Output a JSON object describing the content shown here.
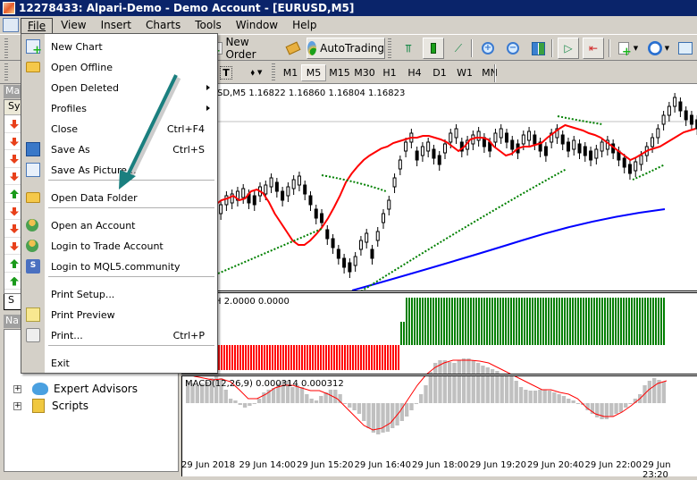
{
  "window": {
    "title": "12278433: Alpari-Demo - Demo Account - [EURUSD,M5]"
  },
  "menubar": {
    "items": [
      "File",
      "View",
      "Insert",
      "Charts",
      "Tools",
      "Window",
      "Help"
    ],
    "active": "File"
  },
  "toolbar": {
    "new_order_label": "New Order",
    "autotrading_label": "AutoTrading",
    "icons": [
      "new-chart-icon",
      "profiles-icon",
      "new-order-icon",
      "metaeditor-icon",
      "autotrading-icon",
      "bar-chart-icon",
      "candlestick-icon",
      "line-chart-icon",
      "zoom-in-icon",
      "zoom-out-icon",
      "tile-windows-icon",
      "chart-shift-icon",
      "autoscroll-icon",
      "indicators-icon",
      "periods-icon",
      "templates-icon",
      "text-label-icon",
      "arrows-icon"
    ]
  },
  "timeframes": {
    "items": [
      "M1",
      "M5",
      "M15",
      "M30",
      "H1",
      "H4",
      "D1",
      "W1",
      "MN"
    ],
    "active": "M5"
  },
  "market_watch": {
    "header": "Ma",
    "column": "Sy",
    "rows": [
      "down",
      "down",
      "down",
      "down",
      "up",
      "down",
      "down",
      "down",
      "up",
      "up"
    ],
    "tab_label": "S"
  },
  "navigator": {
    "header": "Na",
    "items": [
      {
        "label": "Expert Advisors",
        "icon": "expert-advisors-icon"
      },
      {
        "label": "Scripts",
        "icon": "scripts-icon"
      }
    ]
  },
  "file_menu": {
    "items": [
      {
        "label": "New Chart",
        "icon": "new-chart-icon",
        "shortcut": "",
        "submenu": false
      },
      {
        "label": "Open Offline",
        "icon": "open-offline-icon",
        "shortcut": "",
        "submenu": false
      },
      {
        "label": "Open Deleted",
        "icon": "",
        "shortcut": "",
        "submenu": true
      },
      {
        "label": "Profiles",
        "icon": "",
        "shortcut": "",
        "submenu": true
      },
      {
        "label": "Close",
        "icon": "",
        "shortcut": "Ctrl+F4",
        "submenu": false
      },
      {
        "label": "Save As",
        "icon": "save-icon",
        "shortcut": "Ctrl+S",
        "submenu": false
      },
      {
        "label": "Save As Picture...",
        "icon": "save-picture-icon",
        "shortcut": "",
        "submenu": false
      },
      {
        "label": "Open Data Folder",
        "icon": "folder-icon",
        "shortcut": "",
        "submenu": false
      },
      {
        "label": "Open an Account",
        "icon": "open-account-icon",
        "shortcut": "",
        "submenu": false
      },
      {
        "label": "Login to Trade Account",
        "icon": "login-account-icon",
        "shortcut": "",
        "submenu": false
      },
      {
        "label": "Login to MQL5.community",
        "icon": "mql5-login-icon",
        "shortcut": "",
        "submenu": false
      },
      {
        "label": "Print Setup...",
        "icon": "",
        "shortcut": "",
        "submenu": false
      },
      {
        "label": "Print Preview",
        "icon": "print-preview-icon",
        "shortcut": "",
        "submenu": false
      },
      {
        "label": "Print...",
        "icon": "print-icon",
        "shortcut": "Ctrl+P",
        "submenu": false
      },
      {
        "label": "Exit",
        "icon": "",
        "shortcut": "",
        "submenu": false
      }
    ]
  },
  "chart": {
    "main_label": "SD,M5  1.16822 1.16860 1.16804 1.16823",
    "indicator_label": "H 2.0000 0.0000",
    "macd_label": "MACD(12,26,9) 0.000314 0.000312",
    "time_axis": [
      "29 Jun 2018",
      "29 Jun 14:00",
      "29 Jun 15:20",
      "29 Jun 16:40",
      "29 Jun 18:00",
      "29 Jun 19:20",
      "29 Jun 20:40",
      "29 Jun 22:00",
      "29 Jun 23:20"
    ],
    "colors": {
      "ma_fast": "#ff0000",
      "ma_slow": "#0000ff",
      "sar": "#008000",
      "hist_up": "#008000",
      "hist_down": "#ff0000",
      "macd_hist": "#c0c0c0",
      "macd_signal": "#ff0000"
    }
  },
  "annotation": {
    "arrow_color": "#1a7f7f",
    "points_to": "Open Data Folder"
  }
}
